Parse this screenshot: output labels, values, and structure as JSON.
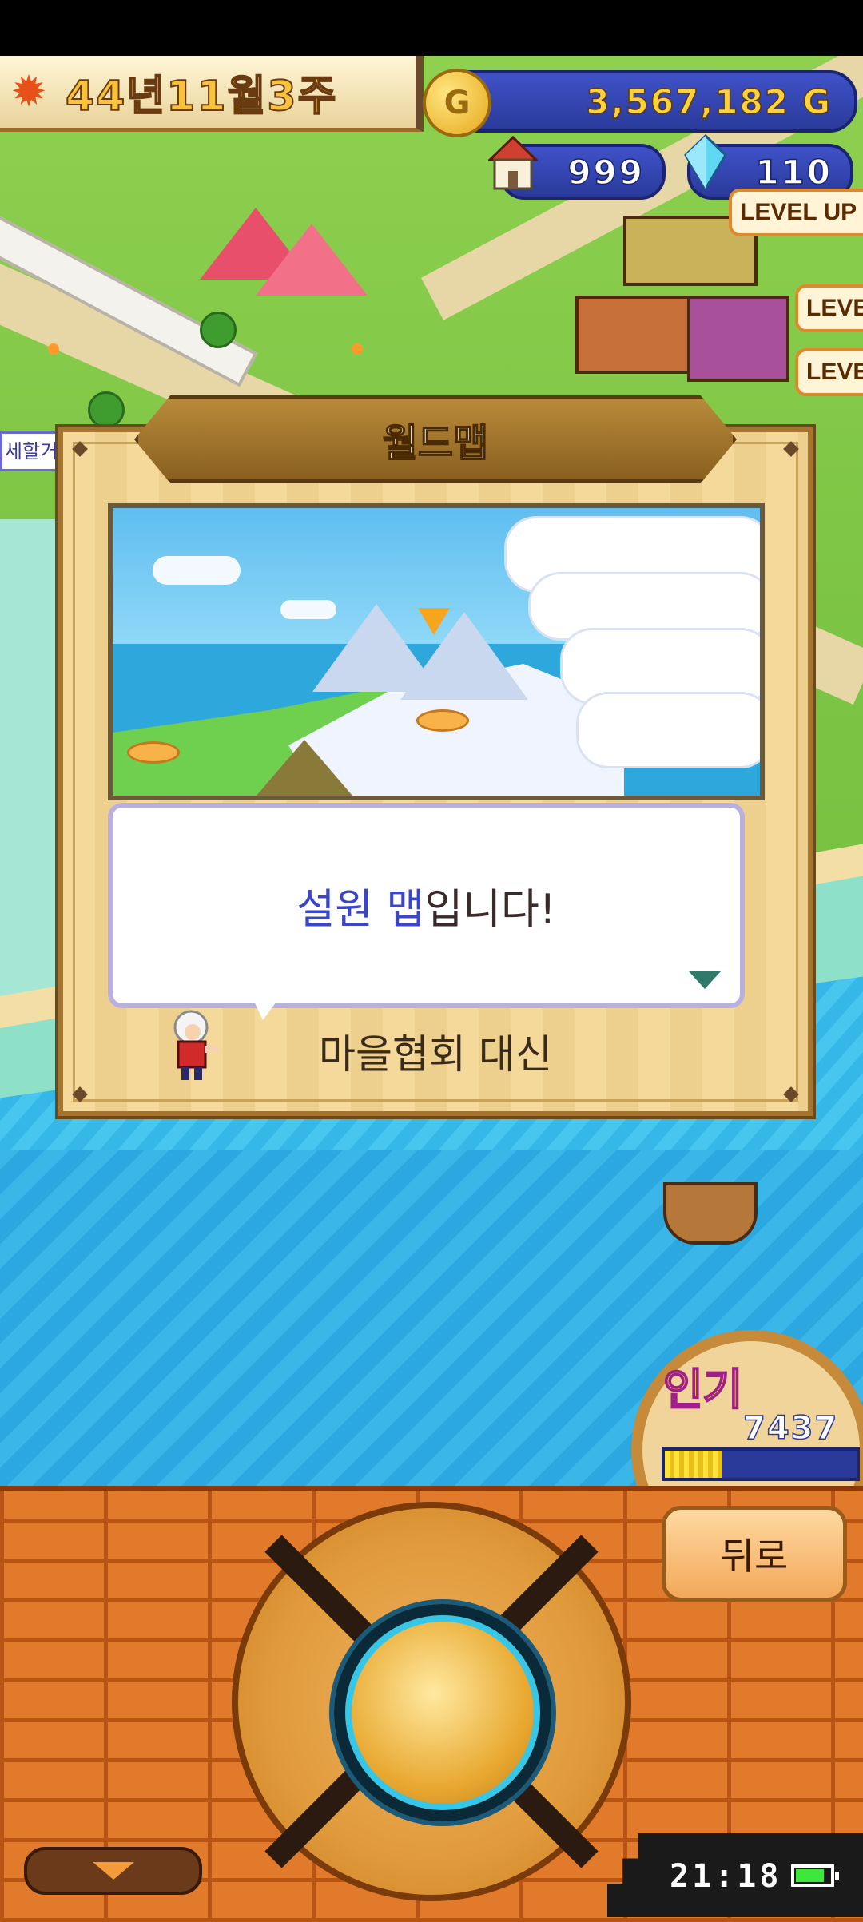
{
  "hud": {
    "date": "44년11월3주",
    "money": "3,567,182 G",
    "coin_symbol": "G",
    "residents": "999",
    "gems": "110",
    "level_up_labels": [
      "LEVEL UP",
      "LEVEL",
      "LEVEL"
    ],
    "side_tag": "세할거"
  },
  "dialog": {
    "title": "월드맵",
    "message_highlight": "설원 맵",
    "message_rest": "입니다!",
    "speaker": "마을협회 대신"
  },
  "popularity": {
    "label": "인기",
    "value": "7437",
    "fill_fraction": 0.3
  },
  "controls": {
    "back_label": "뒤로"
  },
  "system": {
    "clock": "21:18",
    "battery_level": 0.85
  },
  "colors": {
    "highlight_text": "#3a46c8",
    "panel_brick": "#e27a2c",
    "hud_blue": "#2a3a9a"
  }
}
